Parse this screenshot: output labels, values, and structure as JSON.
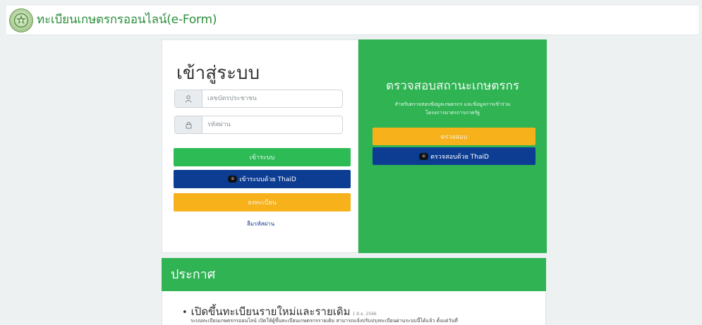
{
  "header": {
    "title": "ทะเบียนเกษตรกรออนไลน์(e-Form)",
    "logo_icon": "department-seal-icon"
  },
  "login": {
    "title": "เข้าสู่ระบบ",
    "username_placeholder": "เลขบัตรประชาชน",
    "password_placeholder": "รหัสผ่าน",
    "login_button": "เข้าระบบ",
    "thaid_button": "เข้าระบบด้วย ThaiD",
    "register_button": "ลงทะเบียน",
    "forgot_link": "ลืมรหัสผ่าน",
    "user_icon": "user-icon",
    "lock_icon": "lock-icon"
  },
  "verify": {
    "title": "ตรวจสอบสถานะเกษตรกร",
    "subtitle": "สำหรับตรวจสอบข้อมูลเกษตรกร และข้อมูลการเข้าร่วม\nโครงการมาตรการภาครัฐ",
    "check_button": "ตรวจสอบ",
    "thaid_button": "ตรวจสอบด้วย ThaiD"
  },
  "announcement": {
    "header": "ประกาศ",
    "items": [
      {
        "title": "เปิดขึ้นทะเบียนรายใหม่และรายเดิม",
        "date": "1 มิ.ย. 2566",
        "text": "ระบบทะเบียนเกษตรกรออนไลน์ เปิดให้ผู้ขึ้นทะเบียนเกษตรกรรายเดิม สามารถแจ้งปรับปรุงทะเบียนผ่านระบบนี้ได้แล้ว ตั้งแต่วันที่"
      }
    ]
  },
  "colors": {
    "green": "#2fb353",
    "blue": "#0c3d92",
    "yellow": "#f7b11b",
    "title_green": "#2d8f3c"
  }
}
